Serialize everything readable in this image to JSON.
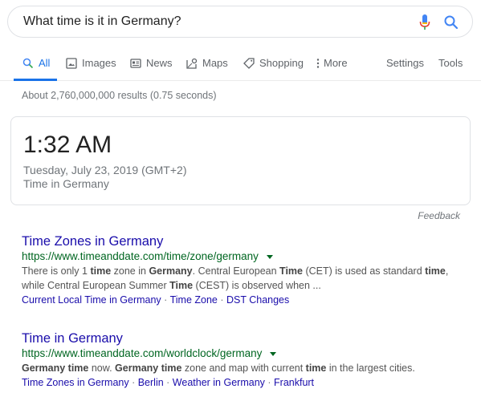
{
  "search": {
    "query": "What time is it in Germany?",
    "mic_icon": "microphone-icon",
    "search_icon": "search-icon"
  },
  "tabs": [
    {
      "label": "All",
      "icon": "search-icon",
      "active": true
    },
    {
      "label": "Images",
      "icon": "image-icon"
    },
    {
      "label": "News",
      "icon": "news-icon"
    },
    {
      "label": "Maps",
      "icon": "map-icon"
    },
    {
      "label": "Shopping",
      "icon": "tag-icon"
    },
    {
      "label": "More",
      "icon": "more-vert-icon"
    }
  ],
  "tools": {
    "settings": "Settings",
    "tools": "Tools"
  },
  "stats": "About 2,760,000,000 results (0.75 seconds)",
  "time_card": {
    "time": "1:32 AM",
    "date": "Tuesday, July 23, 2019 (GMT+2)",
    "location": "Time in Germany"
  },
  "feedback": "Feedback",
  "results": [
    {
      "title": "Time Zones in Germany",
      "url": "https://www.timeanddate.com/time/zone/germany",
      "snippet_parts": [
        [
          "There is only 1 ",
          false
        ],
        [
          "time",
          true
        ],
        [
          " zone in ",
          false
        ],
        [
          "Germany",
          true
        ],
        [
          ". Central European ",
          false
        ],
        [
          "Time",
          true
        ],
        [
          " (CET) is used as standard ",
          false
        ],
        [
          "time",
          true
        ],
        [
          ", while Central European Summer ",
          false
        ],
        [
          "Time",
          true
        ],
        [
          " (CEST) is observed when ...",
          false
        ]
      ],
      "sitelinks": [
        "Current Local Time in Germany",
        "Time Zone",
        "DST Changes"
      ]
    },
    {
      "title": "Time in Germany",
      "url": "https://www.timeanddate.com/worldclock/germany",
      "snippet_parts": [
        [
          "Germany time",
          true
        ],
        [
          " now. ",
          false
        ],
        [
          "Germany time",
          true
        ],
        [
          " zone and map with current ",
          false
        ],
        [
          "time",
          true
        ],
        [
          " in the largest cities.",
          false
        ]
      ],
      "sitelinks": [
        "Time Zones in Germany",
        "Berlin",
        "Weather in Germany",
        "Frankfurt"
      ]
    }
  ],
  "colors": {
    "accent": "#1a73e8",
    "link": "#1a0dab",
    "url": "#006621"
  }
}
